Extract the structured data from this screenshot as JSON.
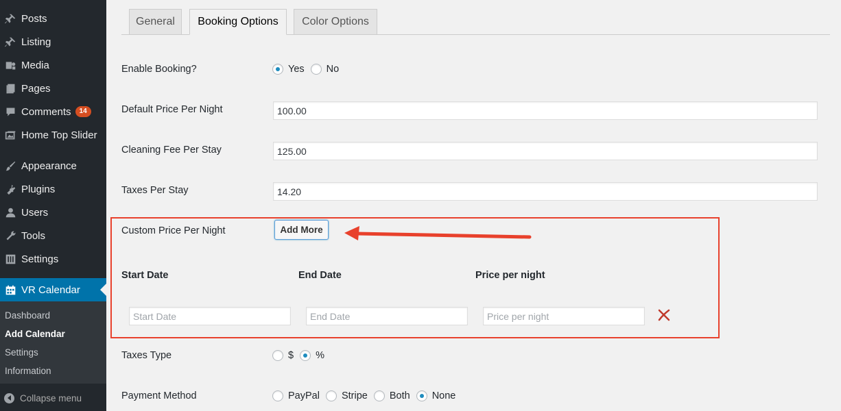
{
  "sidebar": {
    "menu": [
      {
        "label": "Posts",
        "icon": "pin-icon"
      },
      {
        "label": "Listing",
        "icon": "pin-icon"
      },
      {
        "label": "Media",
        "icon": "media-icon"
      },
      {
        "label": "Pages",
        "icon": "pages-icon"
      },
      {
        "label": "Comments",
        "icon": "comment-icon",
        "badge": "14"
      },
      {
        "label": "Home Top Slider",
        "icon": "slider-icon"
      },
      {
        "label": "Appearance",
        "icon": "brush-icon"
      },
      {
        "label": "Plugins",
        "icon": "plugin-icon"
      },
      {
        "label": "Users",
        "icon": "user-icon"
      },
      {
        "label": "Tools",
        "icon": "wrench-icon"
      },
      {
        "label": "Settings",
        "icon": "settings-icon"
      },
      {
        "label": "VR Calendar",
        "icon": "calendar-icon",
        "active": true
      }
    ],
    "submenu": [
      "Dashboard",
      "Add Calendar",
      "Settings",
      "Information"
    ],
    "collapse_label": "Collapse menu"
  },
  "tabs": [
    "General",
    "Booking Options",
    "Color Options"
  ],
  "form": {
    "enable_booking": {
      "label": "Enable Booking?",
      "options": [
        "Yes",
        "No"
      ],
      "selected": "Yes"
    },
    "default_price": {
      "label": "Default Price Per Night",
      "value": "100.00"
    },
    "cleaning_fee": {
      "label": "Cleaning Fee Per Stay",
      "value": "125.00"
    },
    "taxes_per_stay": {
      "label": "Taxes Per Stay",
      "value": "14.20"
    },
    "custom_price": {
      "label": "Custom Price Per Night",
      "add_more_label": "Add More",
      "columns": [
        "Start Date",
        "End Date",
        "Price per night"
      ],
      "placeholders": [
        "Start Date",
        "End Date",
        "Price per night"
      ]
    },
    "taxes_type": {
      "label": "Taxes Type",
      "options": [
        "$",
        "%"
      ],
      "selected": "%"
    },
    "payment_method": {
      "label": "Payment Method",
      "options": [
        "PayPal",
        "Stripe",
        "Both",
        "None"
      ],
      "selected": "None"
    }
  },
  "colors": {
    "accent": "#0073aa",
    "annotation": "#e8412c",
    "sidebar_bg": "#23282d"
  }
}
